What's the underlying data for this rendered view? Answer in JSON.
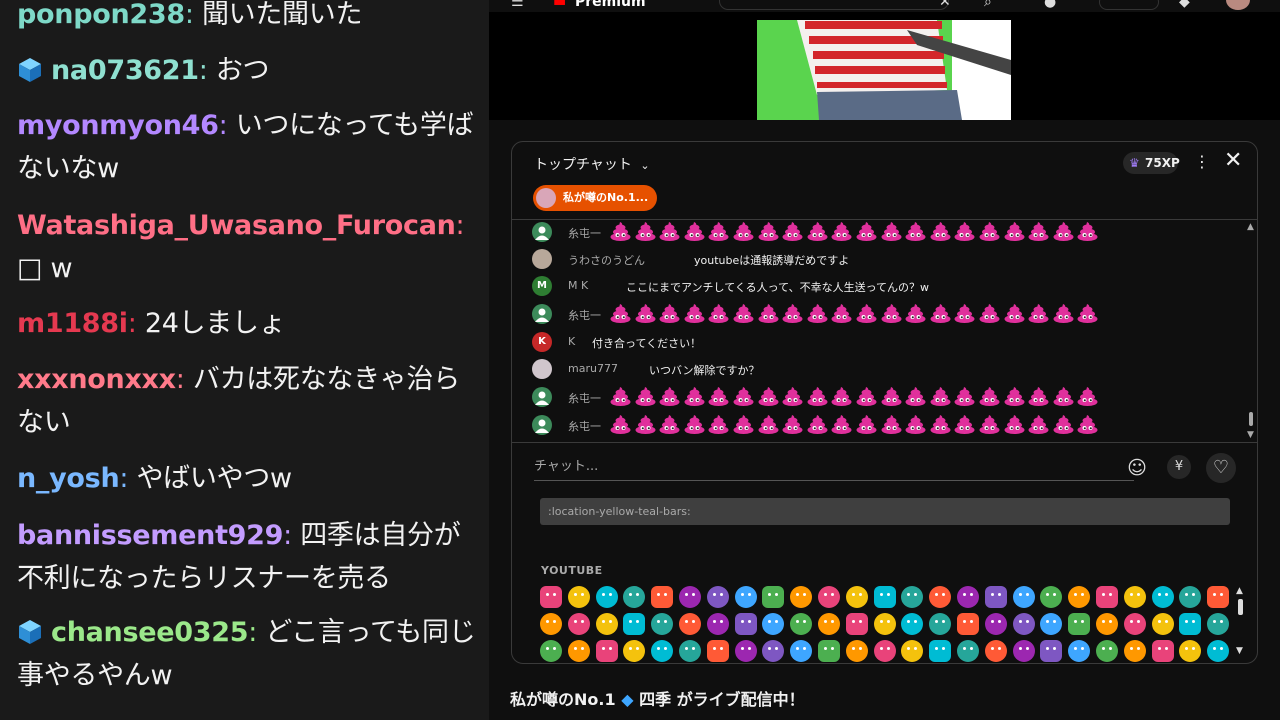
{
  "left_chat": {
    "messages": [
      {
        "user": "ponpon238",
        "user_color": "#7ed9c8",
        "text": "聞いた聞いた",
        "badge": false
      },
      {
        "user": "na073621",
        "user_color": "#8fe0d0",
        "text": "おつ",
        "badge": true
      },
      {
        "user": "myonmyon46",
        "user_color": "#b388ff",
        "text": "いつになっても学ばないなw",
        "badge": false
      },
      {
        "user": "Watashiga_Uwasano_Furocan",
        "user_color": "#ff6f86",
        "text": "□ w",
        "badge": false
      },
      {
        "user": "m1188i",
        "user_color": "#e53950",
        "text": "24しましょ",
        "badge": false
      },
      {
        "user": "xxxnonxxx",
        "user_color": "#ff7a8a",
        "text": "バカは死ななきゃ治らない",
        "badge": false
      },
      {
        "user": "n_yosh",
        "user_color": "#7ab8ff",
        "text": "やばいやつw",
        "badge": false
      },
      {
        "user": "bannissement929",
        "user_color": "#c39cff",
        "text": "四季は自分が不利になったらリスナーを売る",
        "badge": false
      },
      {
        "user": "chansee0325",
        "user_color": "#9be88a",
        "text": "どこ言っても同じ事やるやんw",
        "badge": true
      }
    ]
  },
  "top_bar": {
    "logo_text": "Premium"
  },
  "chat_panel": {
    "mode_label": "トップチャット",
    "xp_badge": "75XP",
    "pinned_label": "私が噂のNo.1...",
    "messages": [
      {
        "avatar": "green",
        "avatar_letter": "",
        "user": "糸屯一",
        "text": "",
        "poo_count": 20
      },
      {
        "avatar": "photo",
        "avatar_letter": "",
        "user": "うわさのうどん",
        "text": "youtubeは通報誘導だめですよ",
        "poo_count": 0
      },
      {
        "avatar": "mk",
        "avatar_letter": "M",
        "user": "M K",
        "text": "ここにまでアンチしてくる人って、不幸な人生送ってんの？w",
        "poo_count": 0
      },
      {
        "avatar": "green",
        "avatar_letter": "",
        "user": "糸屯一",
        "text": "",
        "poo_count": 20
      },
      {
        "avatar": "k",
        "avatar_letter": "K",
        "user": "K",
        "text": "付き合ってください！",
        "poo_count": 0
      },
      {
        "avatar": "photo2",
        "avatar_letter": "",
        "user": "maru777",
        "text": "いつバン解除ですか？",
        "poo_count": 0
      },
      {
        "avatar": "green",
        "avatar_letter": "",
        "user": "糸屯一",
        "text": "",
        "poo_count": 20
      },
      {
        "avatar": "green",
        "avatar_letter": "",
        "user": "糸屯一",
        "text": "",
        "poo_count": 20
      }
    ],
    "input_placeholder": "チャット...",
    "emoji_search_value": ":location-yellow-teal-bars:",
    "emoji_section_label": "YOUTUBE"
  },
  "live_title": {
    "prefix": "私が噂のNo.1",
    "suffix": "四季 がライブ配信中！"
  },
  "colors": {
    "accent_orange": "#e65100",
    "poo_pink": "#e0309c",
    "emoji_palette": [
      "#e9437a",
      "#3ea6ff",
      "#ff5a36",
      "#f4c20d",
      "#4caf50",
      "#9c27b0",
      "#00bcd4",
      "#ff9800",
      "#7e57c2",
      "#26a69a"
    ]
  }
}
